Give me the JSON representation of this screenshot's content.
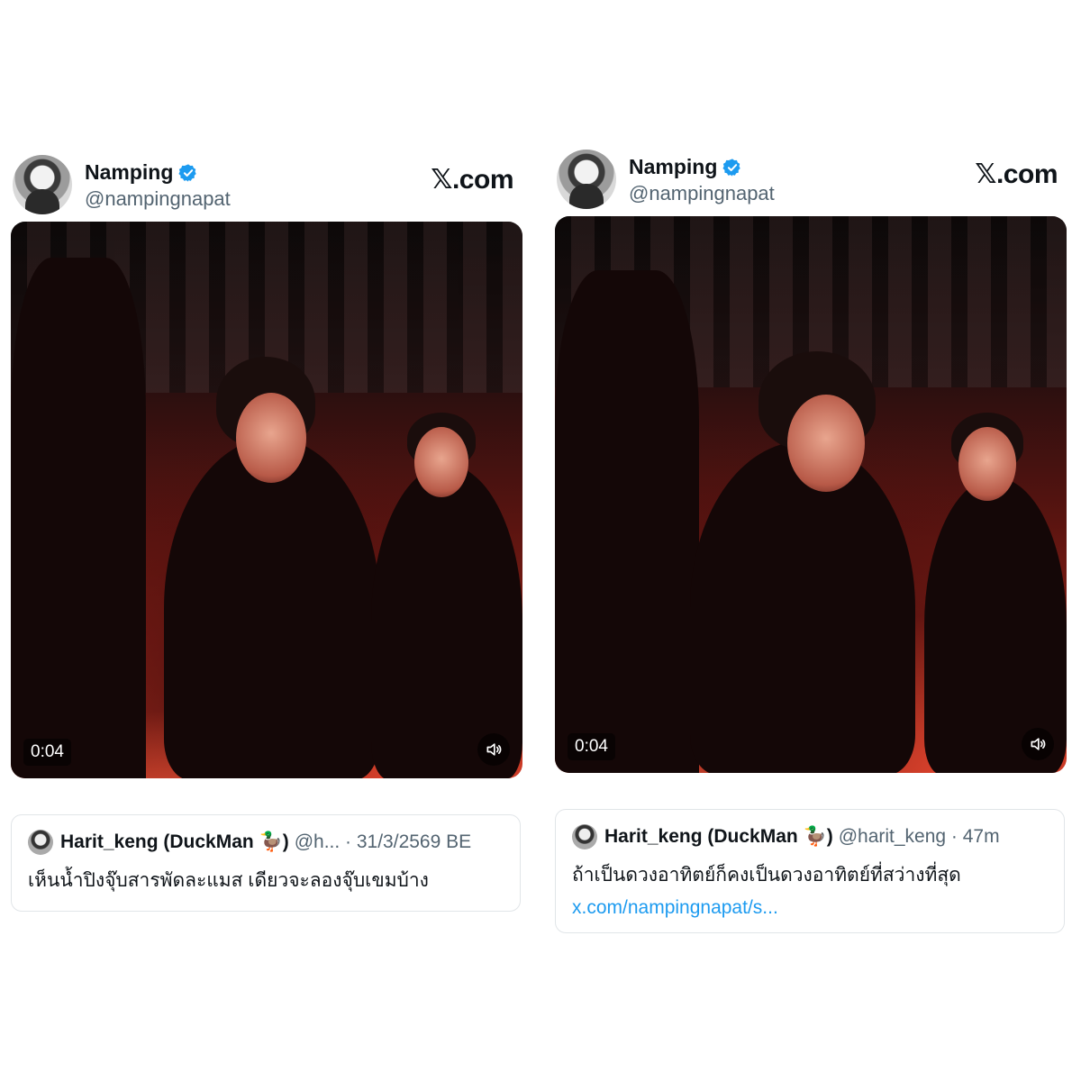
{
  "posts": [
    {
      "author_name": "Namping",
      "author_handle": "@nampingnapat",
      "brand_x": "𝕏",
      "brand_rest": ".com",
      "video_time": "0:04",
      "reply": {
        "name": "Harit_keng (DuckMan 🦆)",
        "meta": "@h... · 31/3/2569 BE",
        "text": "เห็นน้ำปิงจุ๊บสารพัดละแมส เดียวจะลองจุ๊บเขมบ้าง",
        "link": ""
      }
    },
    {
      "author_name": "Namping",
      "author_handle": "@nampingnapat",
      "brand_x": "𝕏",
      "brand_rest": ".com",
      "video_time": "0:04",
      "reply": {
        "name": "Harit_keng (DuckMan 🦆)",
        "meta": "@harit_keng · 47m",
        "text": "ถ้าเป็นดวงอาทิตย์ก็คงเป็นดวงอาทิตย์ที่สว่างที่สุด",
        "link": "x.com/nampingnapat/s..."
      }
    }
  ],
  "colors": {
    "verified": "#1d9bf0",
    "text_primary": "#0f1419",
    "text_secondary": "#536471",
    "link": "#1d9bf0"
  },
  "icons": [
    "verified-badge-icon",
    "volume-icon",
    "x-logo-icon"
  ]
}
